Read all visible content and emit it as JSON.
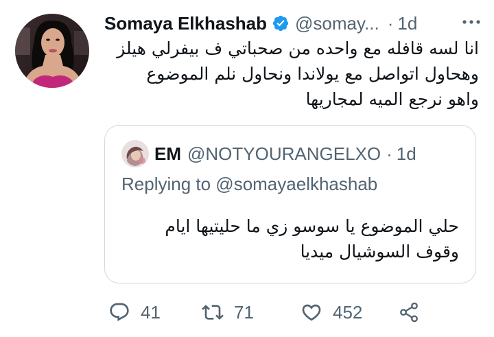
{
  "tweet": {
    "author_name": "Somaya Elkhashab",
    "author_handle": "@somay...",
    "separator": "·",
    "time": "1d",
    "text_lines": [
      "انا لسه قافله مع واحده من صحباتي ف بيفرلي هيلز",
      "وهحاول اتواصل مع يولاندا ونحاول نلم الموضوع",
      "واهو نرجع الميه لمجاريها"
    ]
  },
  "quoted_tweet": {
    "author_name": "EM",
    "author_handle": "@NOTYOURANGELXO",
    "separator": "·",
    "time": "1d",
    "replying_to": "Replying to @somayaelkhashab",
    "text_lines": [
      "حلي الموضوع يا سوسو زي ما حليتيها ايام",
      "وقوف السوشيال ميديا"
    ]
  },
  "actions": {
    "reply_count": "41",
    "retweet_count": "71",
    "like_count": "452"
  },
  "icons": {
    "verified": "verified-badge-icon",
    "more": "more-icon",
    "reply": "reply-icon",
    "retweet": "retweet-icon",
    "like": "heart-icon",
    "share": "share-icon"
  },
  "colors": {
    "verified_blue": "#1d9bf0",
    "text_primary": "#0f1419",
    "text_secondary": "#536471",
    "border": "#cfd9de"
  }
}
